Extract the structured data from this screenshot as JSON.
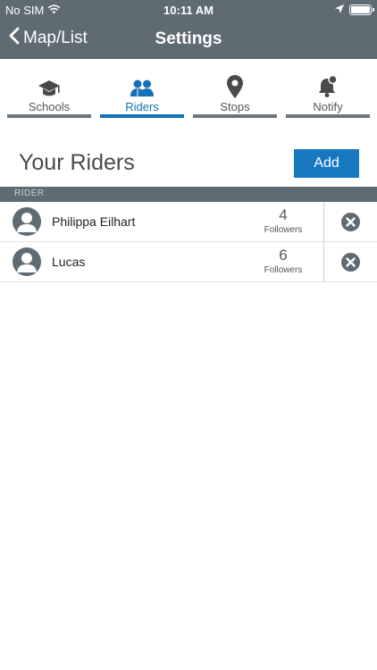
{
  "status_bar": {
    "carrier": "No SIM",
    "time": "10:11 AM",
    "icons": [
      "wifi-icon",
      "location-arrow-icon",
      "battery-icon"
    ]
  },
  "nav": {
    "back_label": "Map/List",
    "title": "Settings"
  },
  "tabs": [
    {
      "label": "Schools",
      "icon": "graduation-cap-icon",
      "active": false
    },
    {
      "label": "Riders",
      "icon": "riders-icon",
      "active": true
    },
    {
      "label": "Stops",
      "icon": "map-pin-icon",
      "active": false
    },
    {
      "label": "Notify",
      "icon": "bell-icon",
      "active": false
    }
  ],
  "main": {
    "heading": "Your Riders",
    "add_label": "Add",
    "section_header": "RIDER"
  },
  "riders": [
    {
      "name": "Philippa Eilhart",
      "followers_count": "4",
      "followers_label": "Followers"
    },
    {
      "name": "Lucas",
      "followers_count": "6",
      "followers_label": "Followers"
    }
  ],
  "colors": {
    "header_bg": "#5f6b73",
    "accent": "#1778c0",
    "tab_bar_inactive": "#6b757c"
  }
}
